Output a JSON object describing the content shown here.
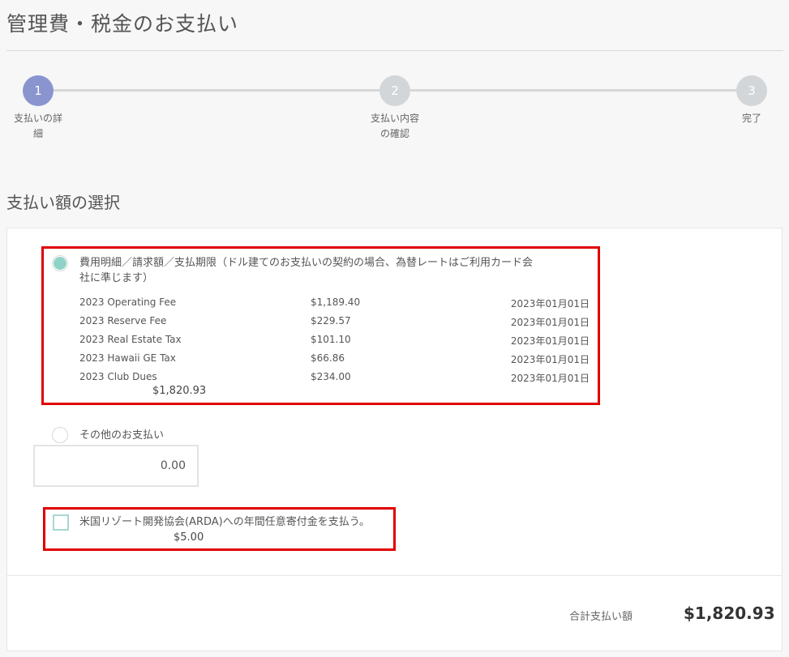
{
  "page": {
    "title": "管理費・税金のお支払い"
  },
  "steps": [
    {
      "number": "1",
      "label_line1": "支払いの詳",
      "label_line2": "細",
      "state": "active"
    },
    {
      "number": "2",
      "label_line1": "支払い内容",
      "label_line2": "の確認",
      "state": "inactive"
    },
    {
      "number": "3",
      "label_line1": "完了",
      "label_line2": "",
      "state": "inactive"
    }
  ],
  "section": {
    "title": "支払い額の選択"
  },
  "option_invoice": {
    "label_line1": "費用明細／請求額／支払期限（ドル建てのお支払いの契約の場合、為替レートはご利用カード会",
    "label_line2": "社に準じます）",
    "selected": true,
    "fees": [
      {
        "name": "2023 Operating Fee",
        "amount": "$1,189.40",
        "due": "2023年01月01日"
      },
      {
        "name": "2023 Reserve Fee",
        "amount": "$229.57",
        "due": "2023年01月01日"
      },
      {
        "name": "2023 Real Estate Tax",
        "amount": "$101.10",
        "due": "2023年01月01日"
      },
      {
        "name": "2023 Hawaii GE Tax",
        "amount": "$66.86",
        "due": "2023年01月01日"
      },
      {
        "name": "2023 Club Dues",
        "amount": "$234.00",
        "due": "2023年01月01日"
      }
    ],
    "subtotal": "$1,820.93"
  },
  "option_other": {
    "label": "その他のお支払い",
    "selected": false,
    "amount_value": "0.00"
  },
  "donation": {
    "label": "米国リゾート開発協会(ARDA)への年間任意寄付金を支払う。",
    "amount": "$5.00",
    "checked": false
  },
  "total": {
    "label": "合計支払い額",
    "value": "$1,820.93"
  },
  "colors": {
    "step_active": "#8a94cf",
    "step_inactive": "#d3d6d8",
    "radio_selected": "#8fd3c8",
    "highlight_border": "#e00000"
  }
}
